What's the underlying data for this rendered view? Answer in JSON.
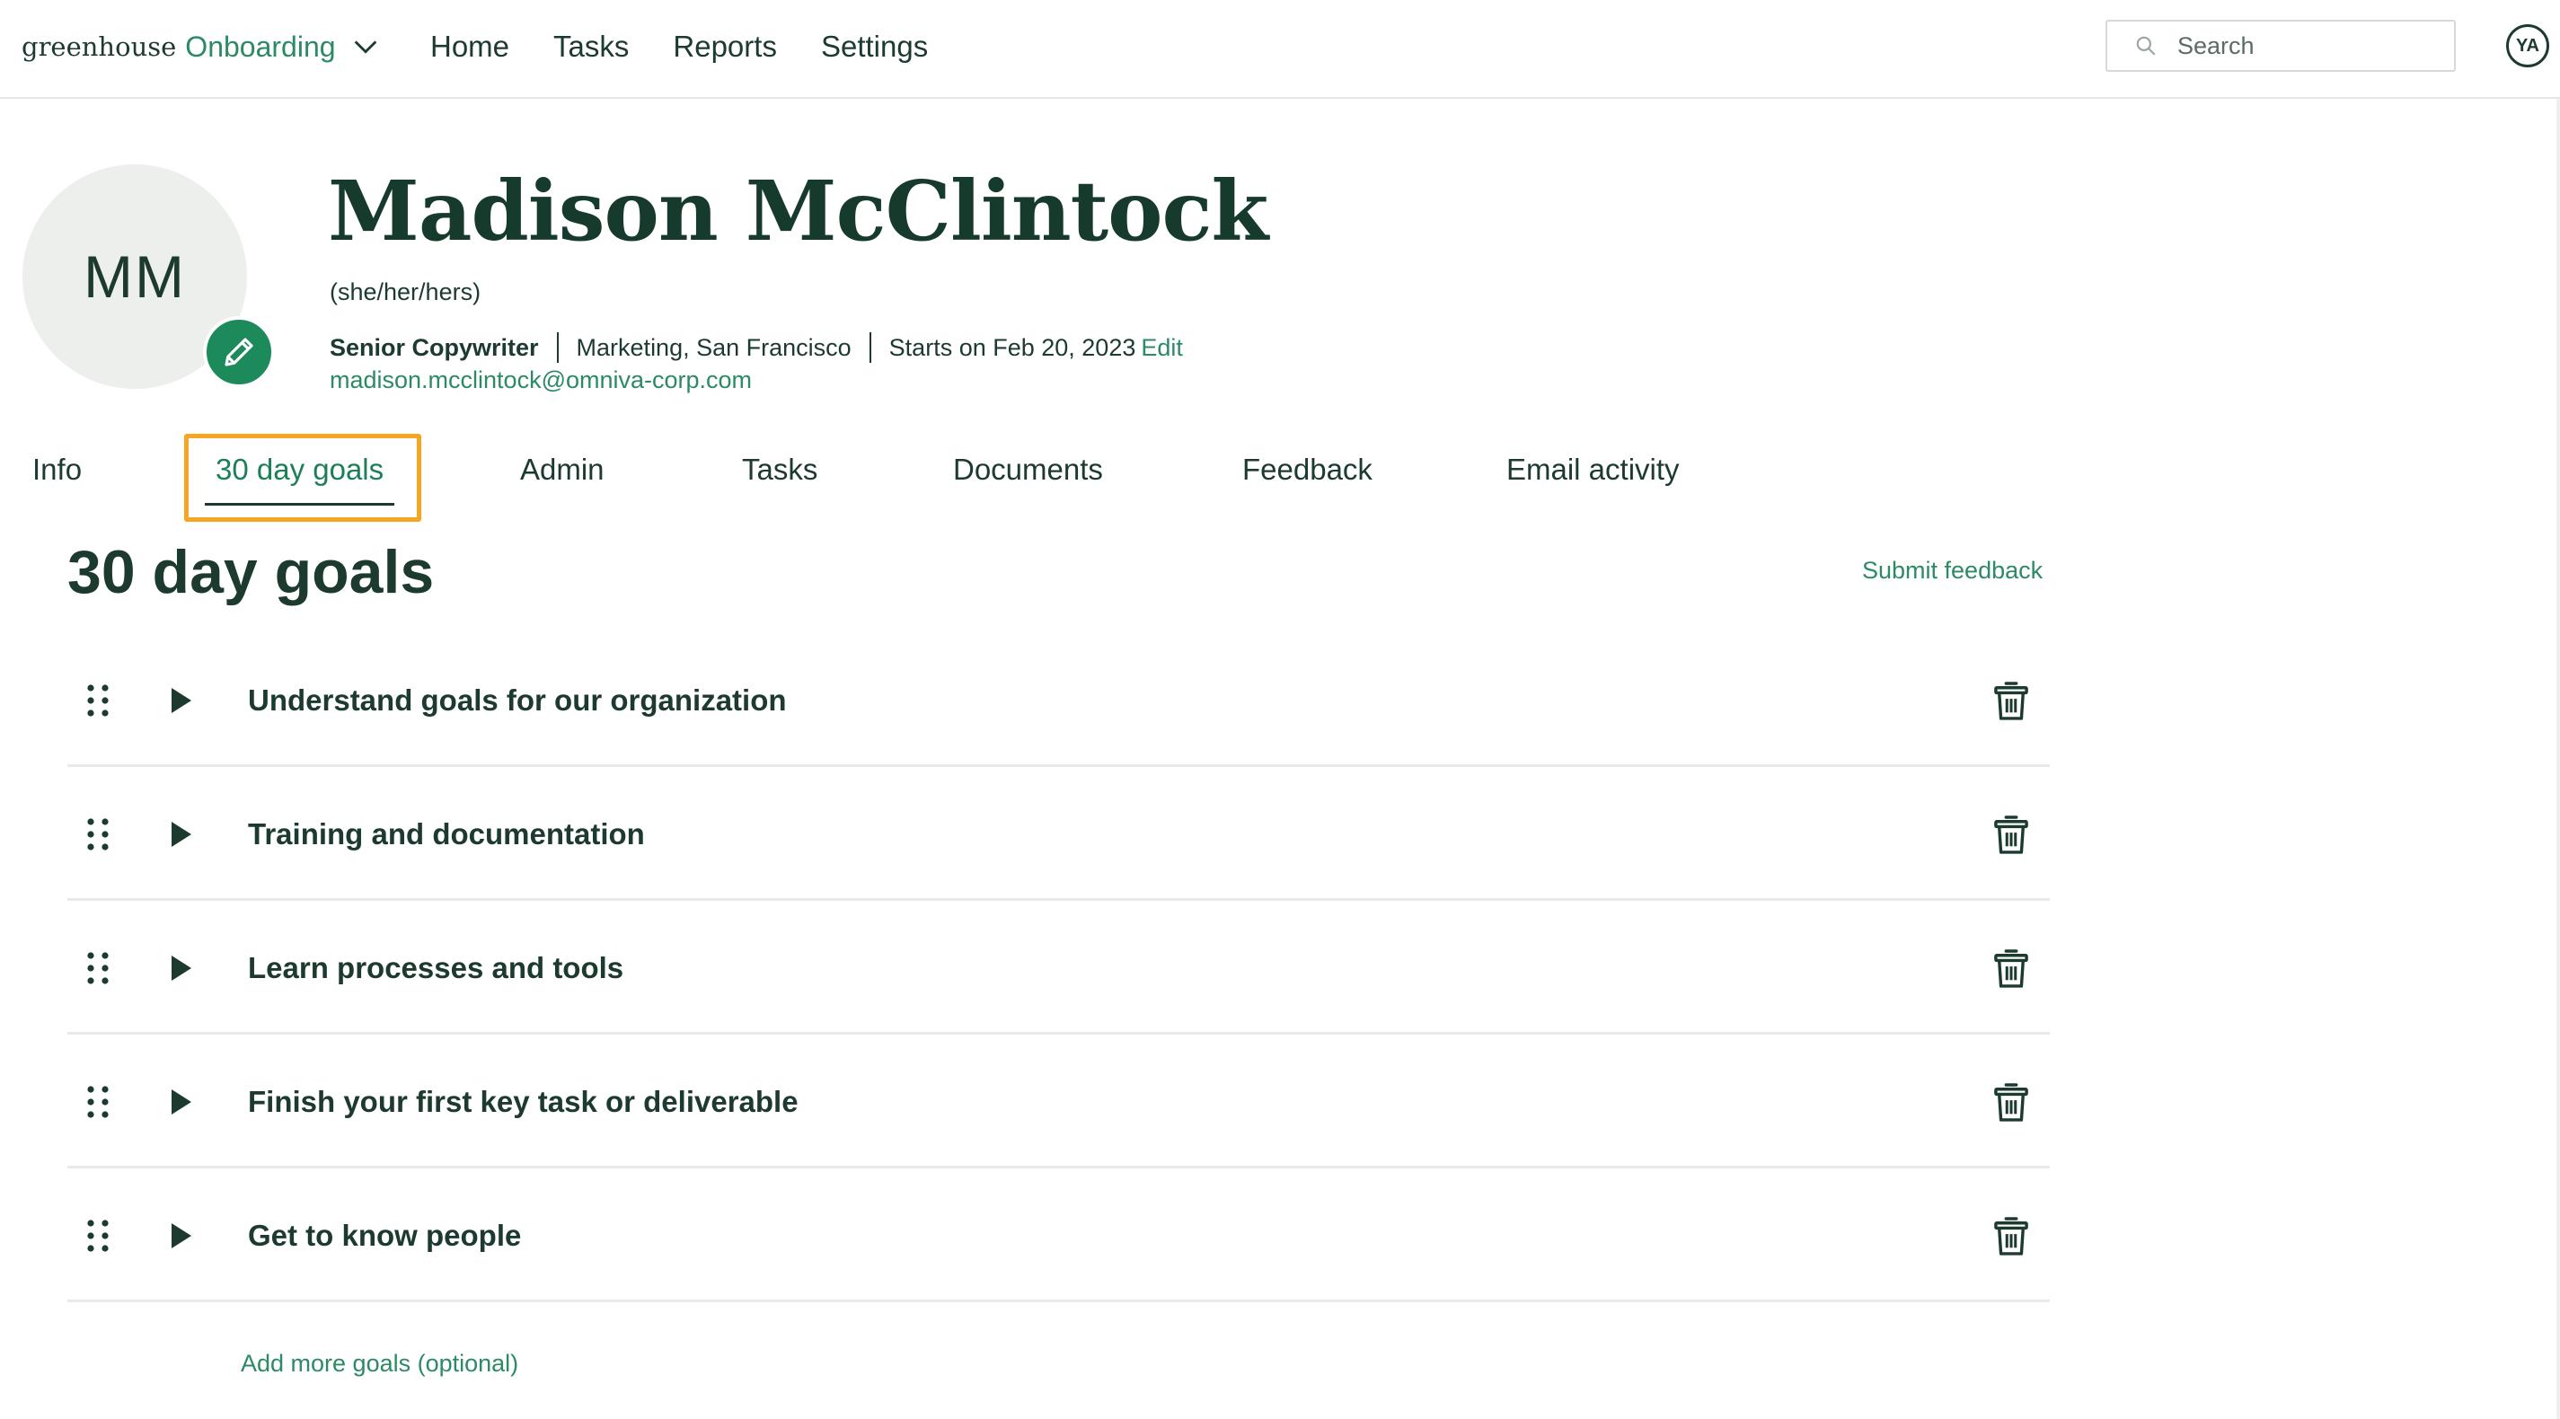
{
  "header": {
    "brand_main": "greenhouse",
    "brand_product": "Onboarding",
    "nav": [
      "Home",
      "Tasks",
      "Reports",
      "Settings"
    ],
    "search_placeholder": "Search",
    "user_initials": "YA"
  },
  "profile": {
    "initials": "MM",
    "name": "Madison McClintock",
    "pronouns": "(she/her/hers)",
    "title": "Senior Copywriter",
    "department_location": "Marketing, San Francisco",
    "start": "Starts on Feb 20, 2023",
    "edit_label": "Edit",
    "email": "madison.mcclintock@omniva-corp.com"
  },
  "tabs": [
    {
      "label": "Info",
      "active": false
    },
    {
      "label": "30 day goals",
      "active": true
    },
    {
      "label": "Admin",
      "active": false
    },
    {
      "label": "Tasks",
      "active": false
    },
    {
      "label": "Documents",
      "active": false
    },
    {
      "label": "Feedback",
      "active": false
    },
    {
      "label": "Email activity",
      "active": false
    }
  ],
  "goals_section": {
    "title": "30 day goals",
    "submit_feedback": "Submit feedback",
    "goals": [
      "Understand goals for our organization",
      "Training and documentation",
      "Learn processes and tools",
      "Finish your first key task or deliverable",
      "Get to know people"
    ],
    "add_more": "Add more goals (optional)"
  },
  "colors": {
    "accent_green": "#2c8a64",
    "text_dark": "#1c3a2e",
    "highlight": "#f5a623",
    "avatar_bg": "#edefed"
  },
  "icons": {
    "brand_dropdown": "chevron-down-icon",
    "search": "search-icon",
    "edit_photo": "pencil-icon",
    "drag": "drag-handle-icon",
    "expand": "caret-right-icon",
    "delete": "trash-icon"
  }
}
